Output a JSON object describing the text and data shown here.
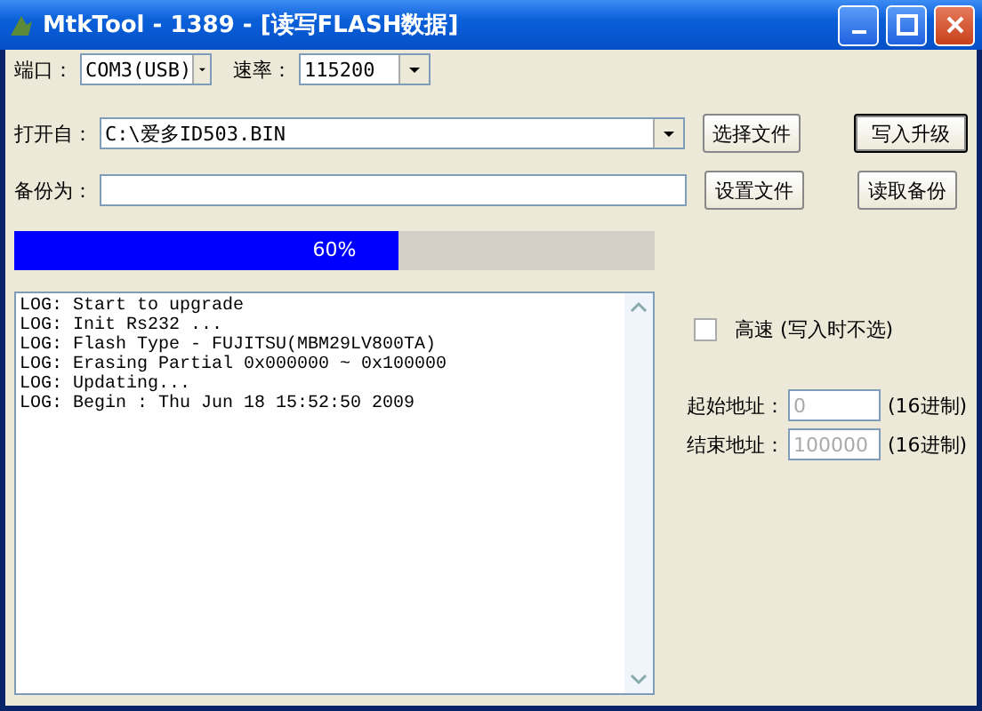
{
  "window": {
    "title": "MtkTool - 1389 - [读写FLASH数据]"
  },
  "port": {
    "label": "端口：",
    "value": "COM3(USB)"
  },
  "baud": {
    "label": "速率：",
    "value": "115200"
  },
  "open_from": {
    "label": "打开自：",
    "value": "C:\\爱多ID503.BIN"
  },
  "backup_as": {
    "label": "备份为："
  },
  "buttons": [
    {
      "label": "选择文件",
      "default": false
    },
    {
      "label": "写入升级",
      "default": true
    },
    {
      "label": "设置文件",
      "default": false
    },
    {
      "label": "读取备份",
      "default": false
    }
  ],
  "progress": {
    "level": 0.6,
    "text": "60%"
  },
  "log": [
    "LOG: Start to upgrade",
    "LOG: Init Rs232 ...",
    "LOG: Flash Type - FUJITSU(MBM29LV800TA)",
    "LOG: Erasing Partial 0x000000 ~ 0x100000",
    "LOG: Updating...",
    "LOG: Begin : Thu Jun 18 15:52:50 2009"
  ],
  "high_speed": {
    "label": "高速 (写入时不选)",
    "checked": false
  },
  "addresses": [
    {
      "label": "起始地址：",
      "value": "0",
      "disabled": true,
      "unit": "(16进制)"
    },
    {
      "label": "结束地址：",
      "value": "100000",
      "disabled": true,
      "unit": "(16进制)"
    }
  ]
}
